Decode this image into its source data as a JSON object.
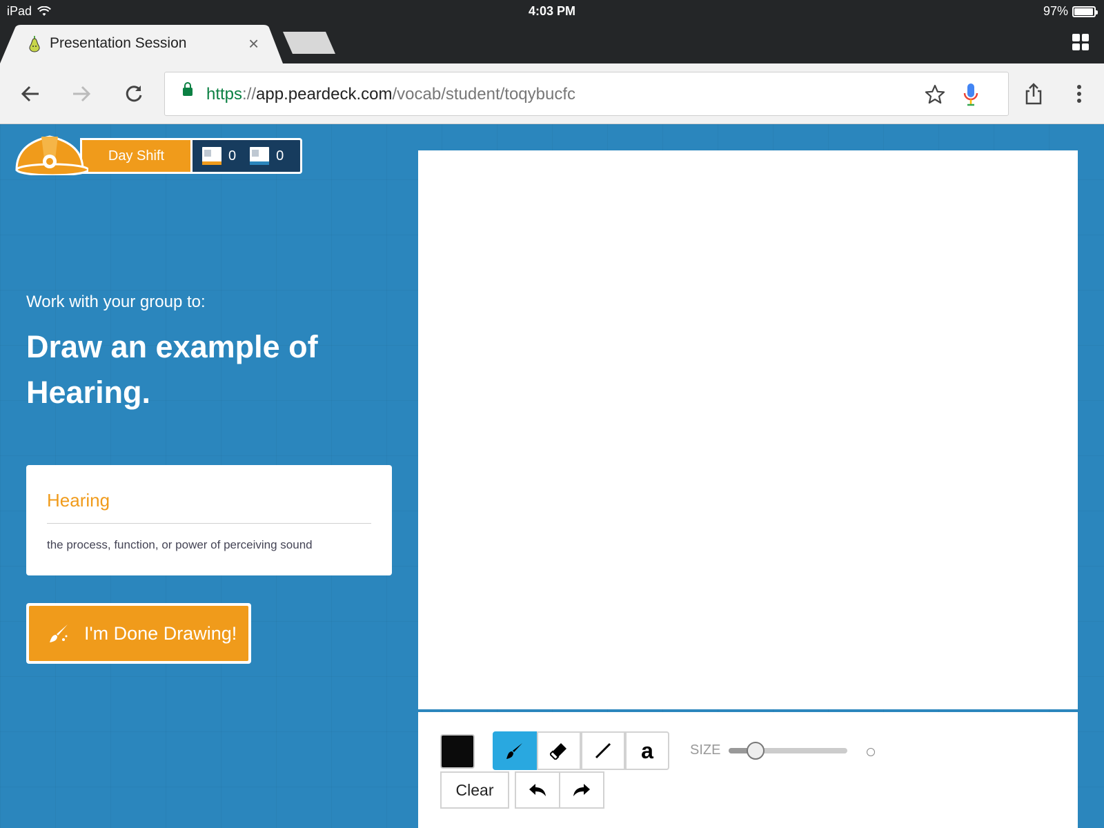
{
  "status_bar": {
    "device": "iPad",
    "time": "4:03 PM",
    "battery": "97%"
  },
  "browser": {
    "tab_title": "Presentation Session",
    "tab_close": "×",
    "url": {
      "scheme": "https",
      "separator": "://",
      "host": "app.peardeck.com",
      "path": "/vocab/student/toqybucfc"
    }
  },
  "header": {
    "shift_label": "Day Shift",
    "score_orange": "0",
    "score_blue": "0"
  },
  "prompt": {
    "intro": "Work with your group to:",
    "main": "Draw an example of Hearing."
  },
  "vocab_card": {
    "term": "Hearing",
    "definition": "the process, function, or power of perceiving sound"
  },
  "done_button": {
    "label": "I'm Done Drawing!"
  },
  "drawing_tools": {
    "size_label": "SIZE",
    "text_tool_glyph": "a",
    "clear_label": "Clear",
    "selected_color": "#0b0b0b",
    "active_tool": "brush",
    "size_level": 0.15
  },
  "colors": {
    "page_bg": "#2b86bd",
    "accent_orange": "#f09b1b",
    "active_tool": "#29a8e0",
    "score_panel": "#173c5e"
  }
}
